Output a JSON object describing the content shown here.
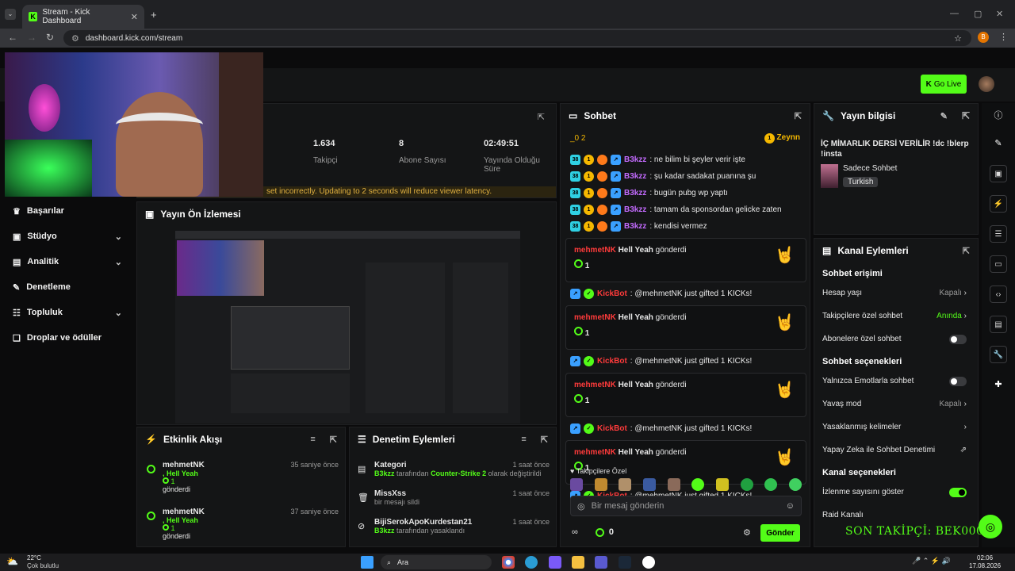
{
  "browser": {
    "tab_title": "Stream - Kick Dashboard",
    "url": "dashboard.kick.com/stream",
    "profile_initial": "B"
  },
  "topbar": {
    "go_live": "Go Live"
  },
  "stats": {
    "viewers": "1.634",
    "viewers_label": "Takipçi",
    "subs": "8",
    "subs_label": "Abone Sayısı",
    "uptime": "02:49:51",
    "uptime_label": "Yayında Olduğu Süre",
    "warning": "set incorrectly. Updating to 2 seconds will reduce viewer latency."
  },
  "sidebar": {
    "items": [
      {
        "label": "Başarılar",
        "icon": "trophy-icon",
        "chevron": false
      },
      {
        "label": "Stüdyo",
        "icon": "studio-icon",
        "chevron": true
      },
      {
        "label": "Analitik",
        "icon": "chart-icon",
        "chevron": true
      },
      {
        "label": "Denetleme",
        "icon": "wrench-icon",
        "chevron": false
      },
      {
        "label": "Topluluk",
        "icon": "community-icon",
        "chevron": true
      },
      {
        "label": "Droplar ve ödüller",
        "icon": "gift-icon",
        "chevron": false
      }
    ]
  },
  "preview": {
    "title": "Yayın Ön İzlemesi"
  },
  "activity": {
    "title": "Etkinlik Akışı",
    "items": [
      {
        "user": "mehmetNK",
        "time": "35 saniye önce",
        "gift": ", Hell Yeah",
        "count": "1",
        "action": "gönderdi"
      },
      {
        "user": "mehmetNK",
        "time": "37 saniye önce",
        "gift": ", Hell Yeah",
        "count": "1",
        "action": "gönderdi"
      }
    ]
  },
  "modlog": {
    "title": "Denetim Eylemleri",
    "items": [
      {
        "title": "Kategori",
        "time": "1 saat önce",
        "user": "B3kzz",
        "text1": " tarafından ",
        "highlight": "Counter-Strike 2",
        "text2": " olarak değiştirildi",
        "icon": "category-icon"
      },
      {
        "title": "MissXss",
        "time": "1 saat önce",
        "user": "",
        "text1": "bir mesajı sildi",
        "highlight": "",
        "text2": "",
        "icon": "trash-icon"
      },
      {
        "title": "BijiSerokApoKurdestan21",
        "time": "1 saat önce",
        "user": "B3kzz",
        "text1": " tarafından yasaklandı",
        "highlight": "",
        "text2": "",
        "icon": "ban-icon"
      }
    ]
  },
  "chat": {
    "title": "Sohbet",
    "pinned_user": "Zeynn",
    "top_counter": "_0 2",
    "messages": [
      {
        "user": "B3kzz",
        "text": ": ne bilim bi şeyler verir işte"
      },
      {
        "user": "B3kzz",
        "text": ": şu kadar sadakat puanına şu"
      },
      {
        "user": "B3kzz",
        "text": ": bugün pubg wp yaptı"
      },
      {
        "user": "B3kzz",
        "text": ": tamam da sponsordan gelicke zaten"
      },
      {
        "user": "B3kzz",
        "text": ": kendisi vermez"
      }
    ],
    "gift_user": "mehmetNK",
    "gift_name": "Hell Yeah",
    "gift_action": "gönderdi",
    "gift_count": "1",
    "bot_user": "KickBot",
    "bot_text": ": @mehmetNK just gifted 1 KICKs!",
    "followers_only": "Takipçilere Özel",
    "input_placeholder": "Bir mesaj gönderin",
    "send": "Gönder",
    "points": "0"
  },
  "streaminfo": {
    "title": "Yayın bilgisi",
    "stream_title": "İÇ MİMARLIK DERSİ VERİLİR !dc !blerp !insta",
    "category": "Sadece Sohbet",
    "language": "Turkish"
  },
  "channel_actions": {
    "title": "Kanal Eylemleri",
    "sec1": "Sohbet erişimi",
    "rows1": [
      {
        "label": "Hesap yaşı",
        "value": "Kapalı",
        "type": "chevron"
      },
      {
        "label": "Takipçilere özel sohbet",
        "value": "Anında",
        "type": "chevron-green"
      },
      {
        "label": "Abonelere özel sohbet",
        "value": "",
        "type": "toggle-off"
      }
    ],
    "sec2": "Sohbet seçenekleri",
    "rows2": [
      {
        "label": "Yalnızca Emotlarla sohbet",
        "value": "",
        "type": "toggle-off"
      },
      {
        "label": "Yavaş mod",
        "value": "Kapalı",
        "type": "chevron"
      },
      {
        "label": "Yasaklanmış kelimeler",
        "value": "",
        "type": "chevron"
      },
      {
        "label": "Yapay Zeka ile Sohbet Denetimi",
        "value": "",
        "type": "external"
      }
    ],
    "sec3": "Kanal seçenekleri",
    "rows3": [
      {
        "label": "İzlenme sayısını göster",
        "value": "",
        "type": "toggle-on"
      },
      {
        "label": "Raid Kanalı",
        "value": "",
        "type": "none"
      }
    ]
  },
  "overlay": {
    "last_follower": "SON TAKİPÇİ: BEK000"
  },
  "taskbar": {
    "weather_temp": "22°C",
    "weather_text": "Çok bulutlu",
    "search": "Ara",
    "time": "02:06",
    "date": "17.08.2026"
  }
}
